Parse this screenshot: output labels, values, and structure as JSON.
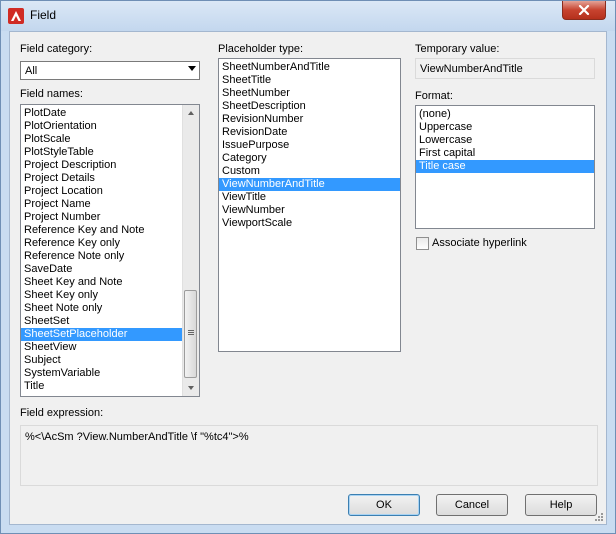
{
  "window": {
    "title": "Field",
    "icon": "autocad-icon",
    "close_icon": "close-icon"
  },
  "field_category": {
    "label": "Field category:",
    "value": "All"
  },
  "field_names": {
    "label": "Field names:",
    "items": [
      "PlotDate",
      "PlotOrientation",
      "PlotScale",
      "PlotStyleTable",
      "Project Description",
      "Project Details",
      "Project Location",
      "Project Name",
      "Project Number",
      "Reference Key and Note",
      "Reference Key only",
      "Reference Note only",
      "SaveDate",
      "Sheet Key and Note",
      "Sheet Key only",
      "Sheet Note only",
      "SheetSet",
      "SheetSetPlaceholder",
      "SheetView",
      "Subject",
      "SystemVariable",
      "Title"
    ],
    "selected": "SheetSetPlaceholder"
  },
  "placeholder_type": {
    "label": "Placeholder type:",
    "items": [
      "SheetNumberAndTitle",
      "SheetTitle",
      "SheetNumber",
      "SheetDescription",
      "RevisionNumber",
      "RevisionDate",
      "IssuePurpose",
      "Category",
      "Custom",
      "ViewNumberAndTitle",
      "ViewTitle",
      "ViewNumber",
      "ViewportScale"
    ],
    "selected": "ViewNumberAndTitle"
  },
  "temporary_value": {
    "label": "Temporary value:",
    "value": "ViewNumberAndTitle"
  },
  "format": {
    "label": "Format:",
    "items": [
      "(none)",
      "Uppercase",
      "Lowercase",
      "First capital",
      "Title case"
    ],
    "selected": "Title case"
  },
  "associate_hyperlink": {
    "label": "Associate hyperlink",
    "checked": false
  },
  "field_expression": {
    "label": "Field expression:",
    "value": "%<\\AcSm ?View.NumberAndTitle \\f \"%tc4\">%"
  },
  "buttons": {
    "ok": "OK",
    "cancel": "Cancel",
    "help": "Help"
  },
  "colors": {
    "selection": "#3399ff",
    "titlebar": "#c9dcf1",
    "close": "#c7432f"
  }
}
